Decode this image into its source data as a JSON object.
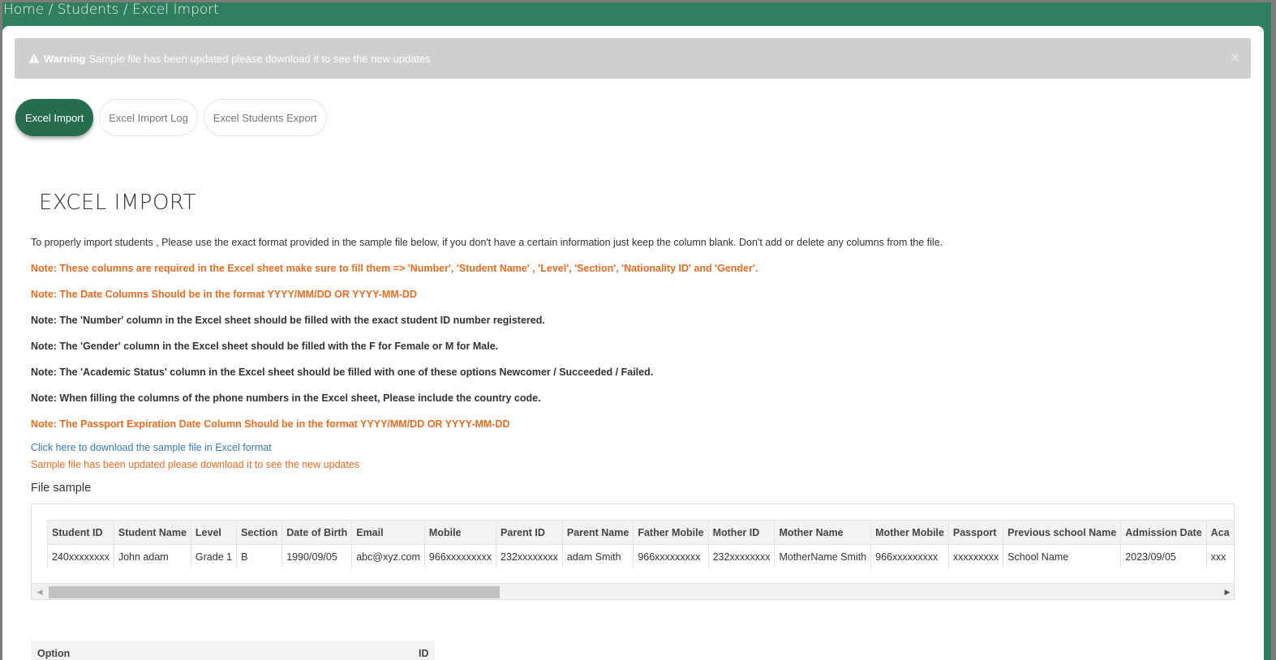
{
  "breadcrumb": {
    "home": "Home",
    "sep1": " / ",
    "students": "Students",
    "sep2": " / ",
    "current": "Excel Import"
  },
  "alert": {
    "icon": "warning-triangle-icon",
    "strong": "Warning",
    "message": "Sample file has been updated please download it to see the new updates",
    "close": "×"
  },
  "tabs": [
    {
      "label": "Excel Import",
      "active": true
    },
    {
      "label": "Excel Import Log",
      "active": false
    },
    {
      "label": "Excel Students Export",
      "active": false
    }
  ],
  "page_title": "EXCEL IMPORT",
  "intro": "To properly import students , Please use the exact format provided in the sample file below, if you don't have a certain information just keep the column blank. Don't add or delete any columns from the file.",
  "notes": [
    "Note: These columns are required in the Excel sheet make sure to fill them => 'Number', 'Student Name' , 'Level', 'Section', 'Nationality ID' and 'Gender'.",
    "Note: The Date Columns Should be in the format YYYY/MM/DD OR YYYY-MM-DD",
    "Note: The 'Number' column in the Excel sheet should be filled with the exact student ID number registered.",
    "Note: The 'Gender' column in the Excel sheet should be filled with the F for Female or M for Male.",
    "Note: The 'Academic Status' column in the Excel sheet should be filled with one of these options Newcomer / Succeeded / Failed.",
    "Note: When filling the columns of the phone numbers in the Excel sheet, Please include the country code.",
    "Note: The Passport Expiration Date Column Should be in the format YYYY/MM/DD OR YYYY-MM-DD"
  ],
  "download_link": "Click here to download the sample file in Excel format",
  "updated_text": "Sample file has been updated please download it to see the new updates",
  "file_sample_title": "File sample",
  "sample_table": {
    "headers": [
      "Student ID",
      "Student Name",
      "Level",
      "Section",
      "Date of Birth",
      "Email",
      "Mobile",
      "Parent ID",
      "Parent Name",
      "Father Mobile",
      "Mother ID",
      "Mother Name",
      "Mother Mobile",
      "Passport",
      "Previous school Name",
      "Admission Date",
      "Aca"
    ],
    "row": [
      "240xxxxxxxx",
      "John adam",
      "Grade 1",
      "B",
      "1990/09/05",
      "abc@xyz.com",
      "966xxxxxxxxx",
      "232xxxxxxxx",
      "adam Smith",
      "966xxxxxxxxx",
      "232xxxxxxxx",
      "MotherName Smith",
      "966xxxxxxxxx",
      "xxxxxxxxx",
      "School Name",
      "2023/09/05",
      "xxx"
    ]
  },
  "scroll": {
    "left_arrow": "◀",
    "right_arrow": "▶"
  },
  "option_table": {
    "col1": "Option",
    "col2": "ID"
  },
  "colors": {
    "brand_green": "#2f7f5f",
    "active_tab": "#266d4d",
    "note_orange": "#ec6b1e",
    "link_blue": "#337ab7"
  }
}
